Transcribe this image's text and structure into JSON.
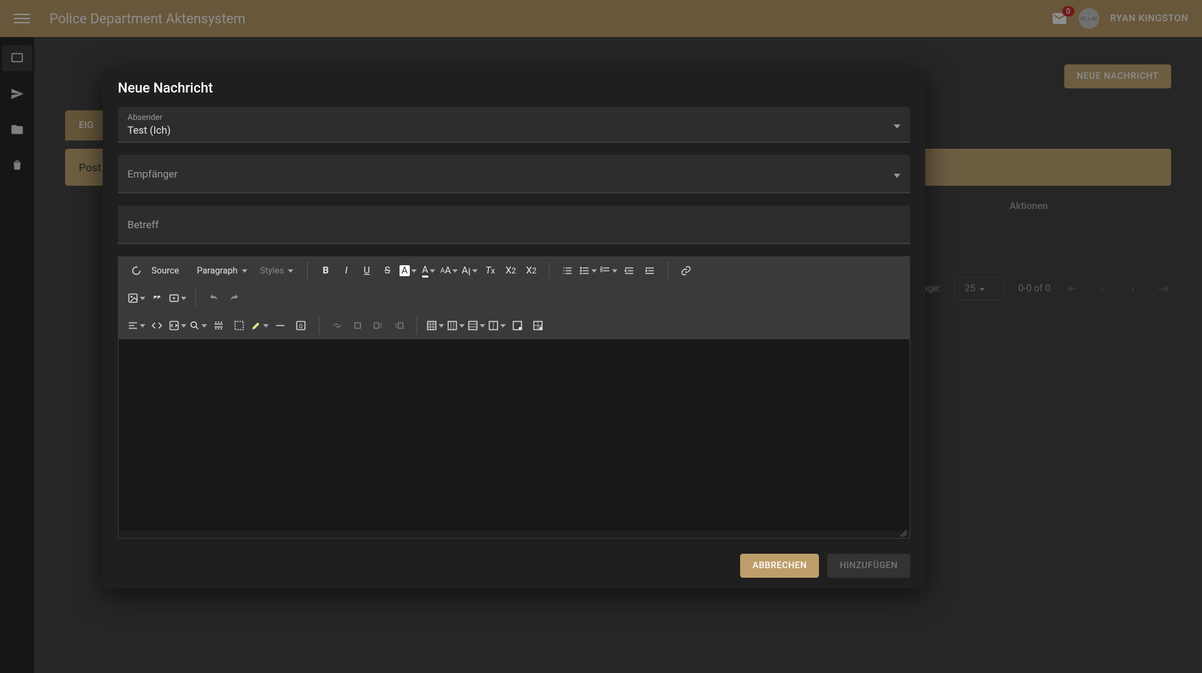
{
  "header": {
    "title": "Police Department Aktensystem",
    "badge_count": "0",
    "avatar_text": "40 x 40",
    "username": "RYAN KINGSTON"
  },
  "sidebar": {
    "items": [
      "inbox",
      "send",
      "folder",
      "trash"
    ]
  },
  "background": {
    "new_message_btn": "NEUE NACHRICHT",
    "tab_left": "EIG",
    "postbox_label": "Post",
    "col_actions": "Aktionen",
    "rows_label": "Rows per page:",
    "rows_value": "25",
    "page_info": "0-0 of 0"
  },
  "modal": {
    "title": "Neue Nachricht",
    "sender_label": "Absender",
    "sender_value": "Test (Ich)",
    "recipient_placeholder": "Empfänger",
    "subject_placeholder": "Betreff",
    "cancel": "ABBRECHEN",
    "submit": "HINZUFÜGEN"
  },
  "editor": {
    "source": "Source",
    "heading": "Paragraph",
    "styles": "Styles"
  }
}
